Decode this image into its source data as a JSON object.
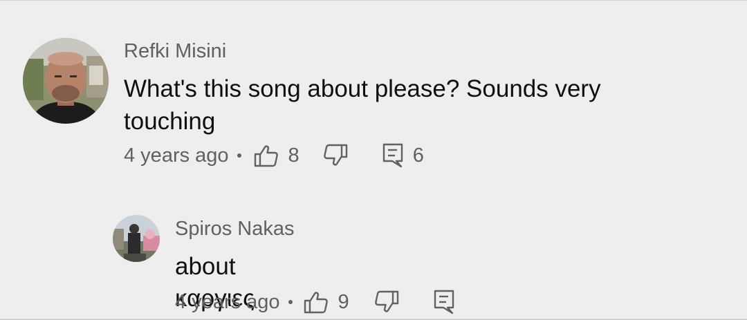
{
  "comments": [
    {
      "author": "Refki Misini",
      "text": "What's this song about please? Sounds very touching",
      "time": "4 years ago",
      "separator": "•",
      "likes": "8",
      "replies": "6",
      "icons": {
        "avatar": "avatar-photo",
        "like": "thumbs-up-icon",
        "dislike": "thumbs-down-icon",
        "reply": "reply-comment-icon"
      }
    },
    {
      "author": "Spiros Nakas",
      "text": "about καργιες",
      "time": "4 years ago",
      "separator": "•",
      "likes": "9",
      "icons": {
        "avatar": "avatar-photo",
        "like": "thumbs-up-icon",
        "dislike": "thumbs-down-icon",
        "reply": "reply-comment-icon"
      }
    }
  ],
  "colors": {
    "background": "#eeeeee",
    "primary_text": "#0f0f0f",
    "secondary_text": "#606060"
  }
}
